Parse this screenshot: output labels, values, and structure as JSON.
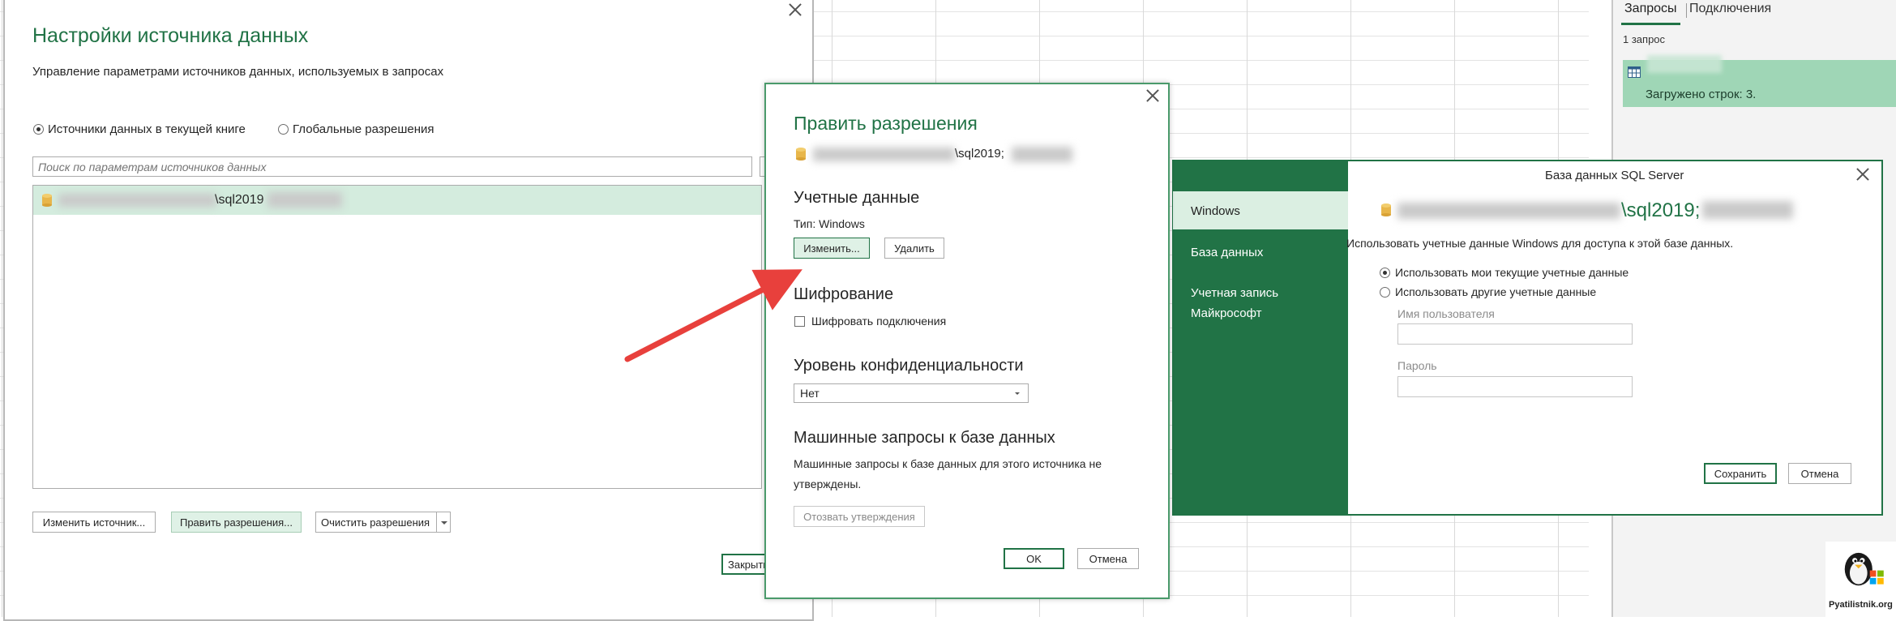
{
  "query_pane": {
    "tabs": [
      "Запросы",
      "Подключения"
    ],
    "count_label": "1 запрос",
    "status": "Загружено строк: 3."
  },
  "ds_dialog": {
    "title": "Настройки источника данных",
    "subtitle": "Управление параметрами источников данных, используемых в запросах",
    "scope_current": "Источники данных в текущей книге",
    "scope_global": "Глобальные разрешения",
    "search_placeholder": "Поиск по параметрам источников данных",
    "source_item": "\\sql2019",
    "change_source": "Изменить источник...",
    "edit_permissions": "Править разрешения...",
    "clear_permissions": "Очистить разрешения",
    "close": "Закрыть"
  },
  "perm_dialog": {
    "title": "Править разрешения",
    "source_path": "\\sql2019;",
    "credentials_heading": "Учетные данные",
    "type_label": "Тип: Windows",
    "edit_btn": "Изменить...",
    "delete_btn": "Удалить",
    "encryption_heading": "Шифрование",
    "encrypt_label": "Шифровать подключения",
    "privacy_heading": "Уровень конфиденциальности",
    "privacy_value": "Нет",
    "native_heading": "Машинные запросы к базе данных",
    "native_text_1": "Машинные запросы к базе данных для этого источника не",
    "native_text_2": "утверждены.",
    "revoke_btn": "Отозвать утверждения",
    "ok": "OK",
    "cancel": "Отмена"
  },
  "sql_dialog": {
    "title": "База данных SQL Server",
    "side_items": [
      "Windows",
      "База данных",
      "Учетная запись",
      "Майкрософт"
    ],
    "server": "\\sql2019;",
    "description": "Использовать учетные данные Windows для доступа к этой базе данных.",
    "opt_current": "Использовать мои текущие учетные данные",
    "opt_other": "Использовать другие учетные данные",
    "username_label": "Имя пользователя",
    "password_label": "Пароль",
    "save": "Сохранить",
    "cancel": "Отмена"
  },
  "logo": {
    "site": "Pyatilistnik.org"
  },
  "colors": {
    "accent": "#217346",
    "highlight": "#dff1e6",
    "arrow": "#e8403c"
  }
}
